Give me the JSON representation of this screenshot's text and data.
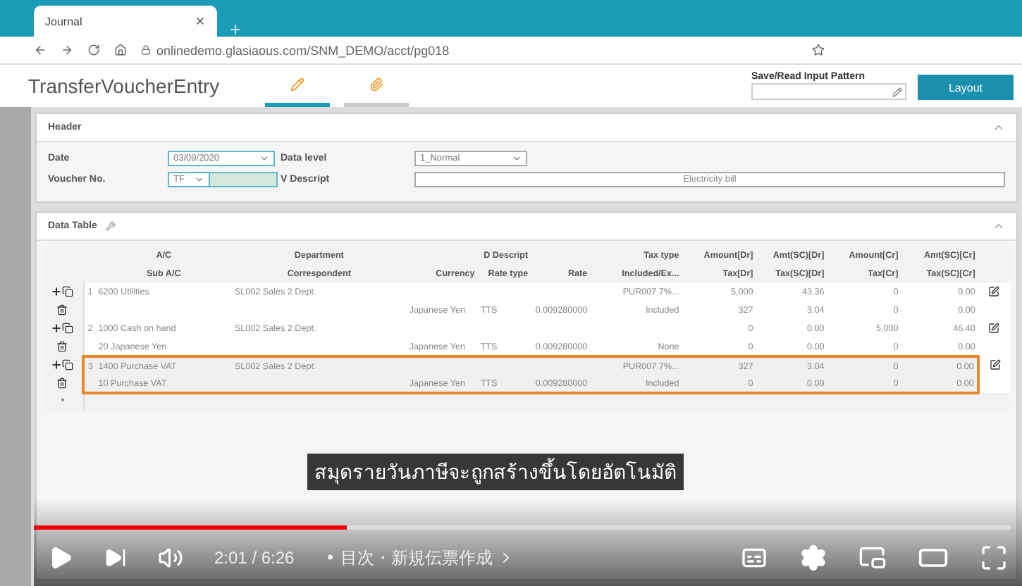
{
  "browser": {
    "tab_title": "Journal",
    "url": "onlinedemo.glasiaous.com/SNM_DEMO/acct/pg018"
  },
  "app": {
    "title": "TransferVoucherEntry",
    "tabs": [
      {
        "kind": "edit",
        "selected": true
      },
      {
        "kind": "attach",
        "selected": false
      }
    ],
    "pattern_label": "Save/Read Input Pattern",
    "layout_button": "Layout"
  },
  "header": {
    "title": "Header",
    "date_label": "Date",
    "date": "03/09/2020",
    "level_label": "Data level",
    "level": "1_Normal",
    "voucher_label": "Voucher No.",
    "voucher": "TF",
    "vdesc_label": "V Descript",
    "vdesc": "Electricity bill"
  },
  "data_table": {
    "title": "Data Table",
    "columns": [
      {
        "top": "A/C",
        "bottom": "Sub A/C"
      },
      {
        "top": "Department",
        "bottom": "Correspondent"
      },
      {
        "bottom": "Currency"
      },
      {
        "top": "D Descript",
        "bottom": "Rate type"
      },
      {
        "bottom": "Rate"
      },
      {
        "top": "Tax type",
        "bottom": "Included/Ex..."
      },
      {
        "top": "Amount[Dr]",
        "bottom": "Tax[Dr]"
      },
      {
        "top": "Amt(SC)[Dr]",
        "bottom": "Tax(SC)[Dr]"
      },
      {
        "top": "Amount[Cr]",
        "bottom": "Tax[Cr]"
      },
      {
        "top": "Amt(SC)[Cr]",
        "bottom": "Tax(SC)[Cr]"
      }
    ],
    "rows": [
      {
        "no": "1",
        "selected": false,
        "account": "6200 Utilities",
        "department": "SL002 Sales 2 Dept.",
        "tax_type": "PUR007 7%...",
        "amount_dr": "5,000",
        "amt_sc_dr": "43.36",
        "amount_cr": "0",
        "amt_sc_cr": "0.00",
        "currency": "Japanese Yen",
        "rate_type": "TTS",
        "rate": "0.009280000",
        "tax_included": "Included",
        "tax_dr": "327",
        "tax_sc_dr": "3.04",
        "tax_cr": "0",
        "tax_sc_cr": "0.00"
      },
      {
        "no": "2",
        "selected": false,
        "account": "1000 Cash on hand",
        "department": "SL002 Sales 2 Dept.",
        "amount_dr": "0",
        "amt_sc_dr": "0.00",
        "amount_cr": "5,000",
        "amt_sc_cr": "46.40",
        "sub_account": "20 Japanese Yen",
        "currency": "Japanese Yen",
        "rate_type": "TTS",
        "rate": "0.009280000",
        "tax_included": "None",
        "tax_dr": "0",
        "tax_sc_dr": "0.00",
        "tax_cr": "0",
        "tax_sc_cr": "0.00"
      },
      {
        "no": "3",
        "selected": true,
        "account": "1400 Purchase VAT",
        "department": "SL002 Sales 2 Dept.",
        "tax_type": "PUR007 7%...",
        "amount_dr": "327",
        "amt_sc_dr": "3.04",
        "amount_cr": "0",
        "amt_sc_cr": "0.00",
        "sub_account": "10 Purchase VAT",
        "currency": "Japanese Yen",
        "rate_type": "TTS",
        "rate": "0.009280000",
        "tax_included": "Included",
        "tax_dr": "0",
        "tax_sc_dr": "0.00",
        "tax_cr": "0",
        "tax_sc_cr": "0.00"
      }
    ],
    "new_row_mark": "*"
  },
  "player": {
    "subtitle": "สมุดรายวันภาษีจะถูกสร้างขึ้นโดยอัตโนมัติ",
    "progress": {
      "level": 0.32
    },
    "time": "2:01 / 6:26",
    "chapter": "• 目次・新規伝票作成"
  }
}
